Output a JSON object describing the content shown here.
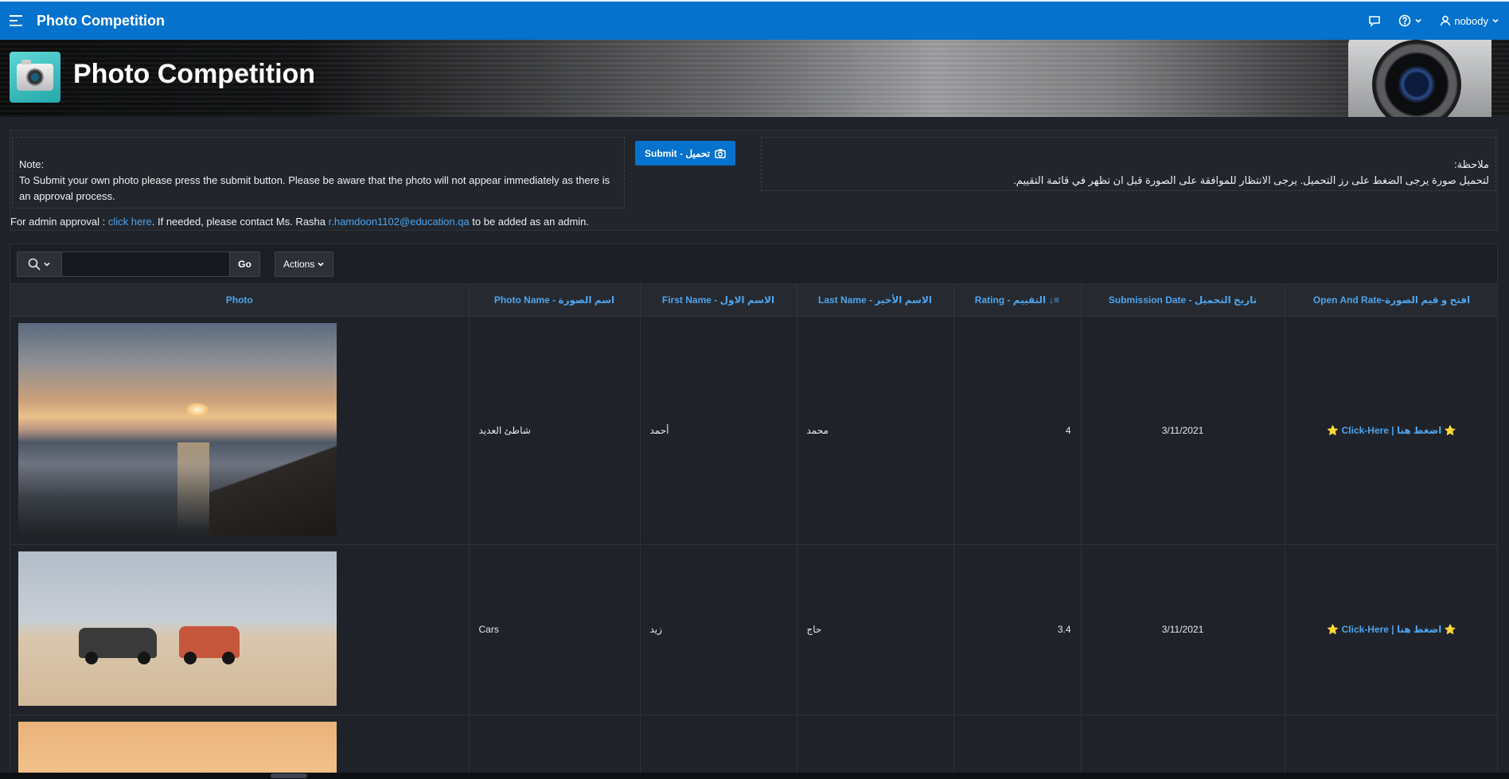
{
  "nav": {
    "title": "Photo Competition",
    "user": "nobody"
  },
  "hero": {
    "title": "Photo Competition"
  },
  "info": {
    "note_en": "Note:\nTo Submit your own photo please press the submit button. Please be aware that the photo will not appear immediately as there is an approval process.",
    "submit_label": "Submit - تحميل",
    "note_ar": "ملاحظة:\nلتحميل صورة يرجى الضغط على رز التحميل. يرجى الانتظار للموافقة على الصورة قبل ان تظهر في قائمة التقييم.",
    "admin_prefix": "For admin approval : ",
    "admin_link": "click here",
    "admin_middle": ". If needed, please contact Ms. Rasha ",
    "admin_email": "r.hamdoon1102@education.qa",
    "admin_suffix": " to be added as an admin."
  },
  "toolbar": {
    "search_value": "",
    "go_label": "Go",
    "actions_label": "Actions"
  },
  "table": {
    "headers": {
      "photo": "Photo",
      "photo_name": "Photo Name - اسم الصورة",
      "first_name": "First Name - الاسم الاول",
      "last_name": "Last Name - الاسم الأخير",
      "rating": "Rating - التقييم",
      "submission_date": "Submission Date - تاريخ التحميل",
      "open_rate": "Open And Rate-افتح و قيم الصورة"
    },
    "rows": [
      {
        "photo_name": "شاطئ العديد",
        "first_name": "أحمد",
        "last_name": "محمد",
        "rating": "4",
        "date": "3/11/2021",
        "link": "Click-Here | اضغط هنا"
      },
      {
        "photo_name": "Cars",
        "first_name": "زيد",
        "last_name": "حاج",
        "rating": "3.4",
        "date": "3/11/2021",
        "link": "Click-Here | اضغط هنا"
      }
    ]
  },
  "icons": {
    "menu": "menu-icon",
    "chat": "chat-icon",
    "help": "help-icon",
    "user": "user-icon",
    "camera": "camera-icon",
    "search": "search-icon",
    "sort": "sort-desc-icon",
    "star": "star-icon"
  },
  "colors": {
    "nav_bg": "#0572ce",
    "page_bg": "#1f2329",
    "link": "#4ea4ee",
    "star": "#ffd700"
  }
}
